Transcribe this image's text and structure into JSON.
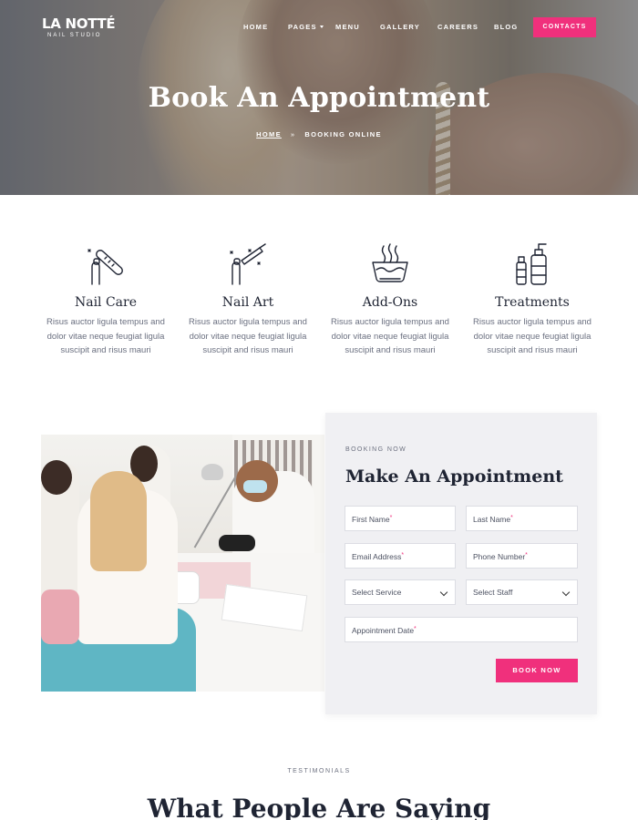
{
  "brand": {
    "name": "LA NOTTÉ",
    "tagline": "NAIL STUDIO"
  },
  "nav": {
    "items": [
      {
        "label": "HOME",
        "has_dropdown": false
      },
      {
        "label": "PAGES",
        "has_dropdown": true
      },
      {
        "label": "MENU",
        "has_dropdown": false
      },
      {
        "label": "GALLERY",
        "has_dropdown": false
      },
      {
        "label": "CAREERS",
        "has_dropdown": false
      },
      {
        "label": "BLOG",
        "has_dropdown": false
      }
    ],
    "cta": "CONTACTS"
  },
  "hero": {
    "title": "Book An Appointment",
    "breadcrumb": {
      "home": "HOME",
      "separator": "»",
      "current": "BOOKING ONLINE"
    }
  },
  "services": [
    {
      "icon": "nail-file-icon",
      "title": "Nail Care",
      "desc": "Risus auctor ligula tempus and dolor vitae neque feugiat ligula suscipit and risus mauri"
    },
    {
      "icon": "nail-polish-brush-icon",
      "title": "Nail Art",
      "desc": "Risus auctor ligula tempus and dolor vitae neque feugiat ligula suscipit and risus mauri"
    },
    {
      "icon": "soaking-bowl-icon",
      "title": "Add-Ons",
      "desc": "Risus auctor ligula tempus and dolor vitae neque feugiat ligula suscipit and risus mauri"
    },
    {
      "icon": "lotion-bottles-icon",
      "title": "Treatments",
      "desc": "Risus auctor ligula tempus and dolor vitae neque feugiat ligula suscipit and risus mauri"
    }
  ],
  "booking": {
    "eyebrow": "BOOKING NOW",
    "heading": "Make An Appointment",
    "fields": {
      "first_name": "First Name",
      "last_name": "Last Name",
      "email": "Email Address",
      "phone": "Phone Number",
      "service": "Select Service",
      "staff": "Select Staff",
      "date": "Appointment Date"
    },
    "required_mark": "*",
    "submit": "BOOK NOW"
  },
  "testimonials": {
    "eyebrow": "TESTIMONIALS",
    "heading": "What People Are Saying"
  },
  "colors": {
    "accent": "#f0307c",
    "heading": "#1f2433",
    "body_text": "#6b7080",
    "panel_bg": "#f0f0f3"
  }
}
